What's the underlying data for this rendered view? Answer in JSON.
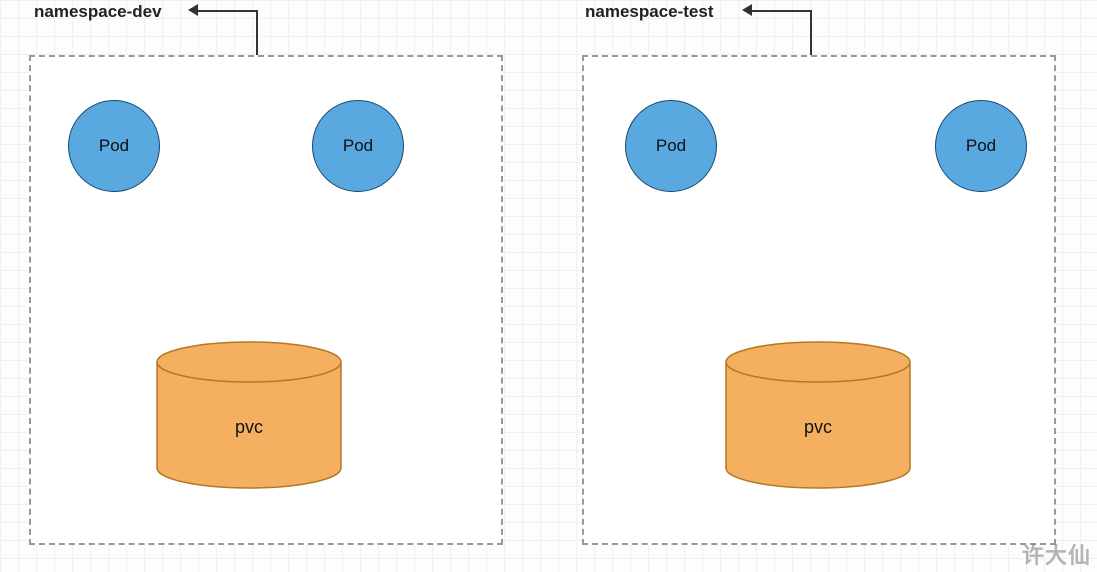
{
  "namespaces": [
    {
      "key": "dev",
      "label": "namespace-dev",
      "pods": [
        "Pod",
        "Pod"
      ],
      "pvc_label": "pvc"
    },
    {
      "key": "test",
      "label": "namespace-test",
      "pods": [
        "Pod",
        "Pod"
      ],
      "pvc_label": "pvc"
    }
  ],
  "watermark": "许大仙",
  "colors": {
    "pod_fill": "#5aa8e0",
    "pod_stroke": "#15496e",
    "pvc_fill": "#f4b060",
    "pvc_stroke": "#b67820",
    "box_border": "#999"
  }
}
